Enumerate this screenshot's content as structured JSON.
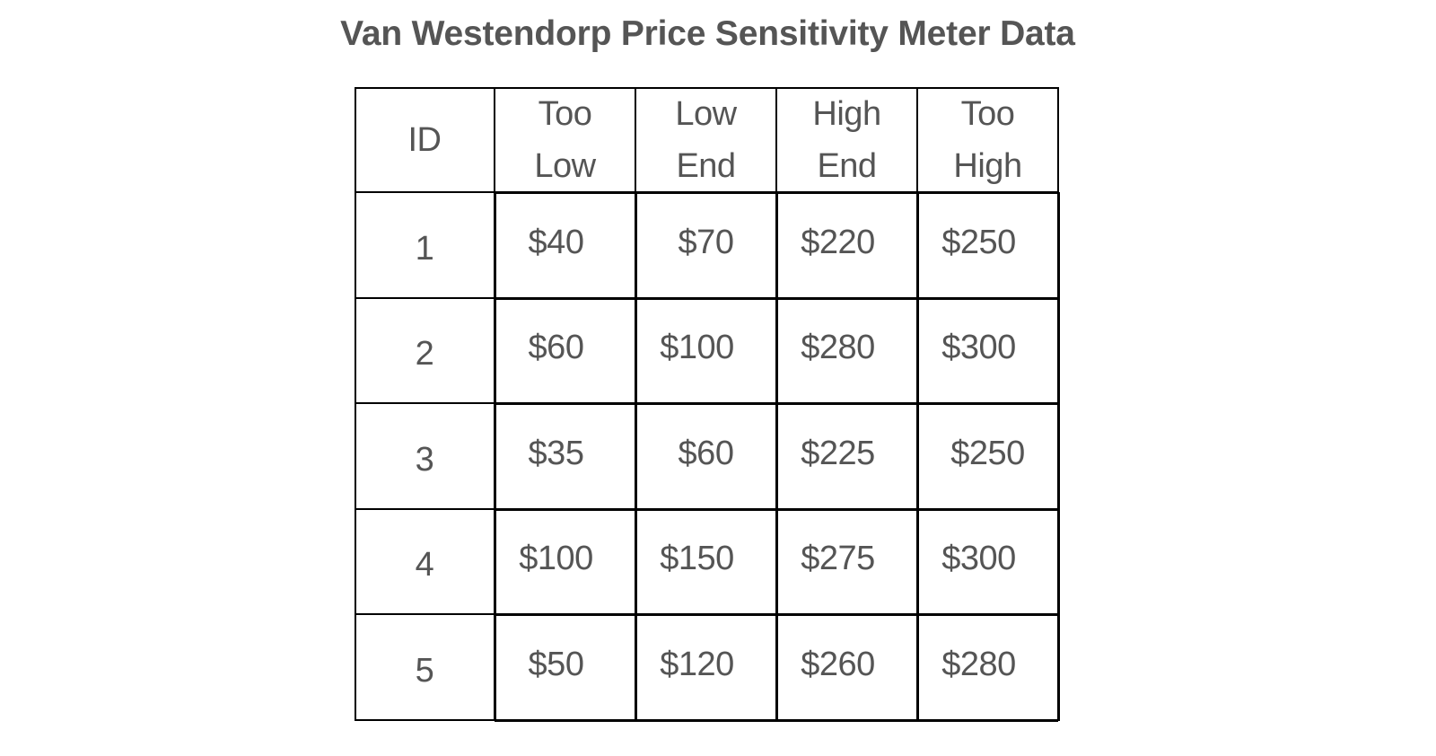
{
  "title": "Van Westendorp Price Sensitivity Meter Data",
  "table": {
    "headers": [
      {
        "lines": [
          "ID"
        ]
      },
      {
        "lines": [
          "Too",
          "Low"
        ]
      },
      {
        "lines": [
          "Low",
          "End"
        ]
      },
      {
        "lines": [
          "High",
          "End"
        ]
      },
      {
        "lines": [
          "Too",
          "High"
        ]
      }
    ],
    "rows": [
      [
        "1",
        "$40",
        "$70",
        "$220",
        "$250"
      ],
      [
        "2",
        "$60",
        "$100",
        "$280",
        "$300"
      ],
      [
        "3",
        "$35",
        "$60",
        "$225",
        "$250"
      ],
      [
        "4",
        "$100",
        "$150",
        "$275",
        "$300"
      ],
      [
        "5",
        "$50",
        "$120",
        "$260",
        "$280"
      ]
    ],
    "border_color": "#000000",
    "text_color": "#555555"
  }
}
